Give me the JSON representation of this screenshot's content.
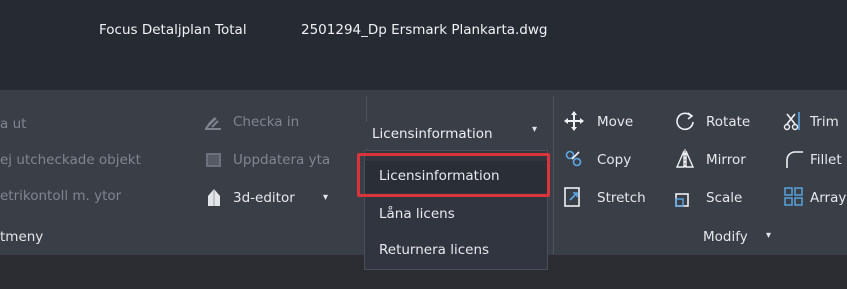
{
  "titlebar": {
    "app_name": "Focus Detaljplan Total",
    "file_name": "2501294_Dp Ersmark Plankarta.dwg"
  },
  "left_panel": {
    "items": [
      "a ut",
      "ej utcheckade objekt",
      "etrikontoll m. ytor"
    ],
    "label": "tmeny"
  },
  "focus_panel": {
    "checka_in": "Checka in",
    "uppdatera_yta": "Uppdatera yta",
    "3d_editor": "3d-editor",
    "3d_editor_caret": "▾"
  },
  "license": {
    "button_label": "Licensinformation",
    "caret": "▾",
    "menu": [
      {
        "label": "Licensinformation",
        "selected": true
      },
      {
        "label": "Låna licens",
        "selected": false
      },
      {
        "label": "Returnera licens",
        "selected": false
      }
    ],
    "highlight_color": "#d9343a"
  },
  "modify_panel": {
    "move": "Move",
    "copy": "Copy",
    "stretch": "Stretch",
    "rotate": "Rotate",
    "mirror": "Mirror",
    "scale": "Scale",
    "trim": "Trim",
    "fillet": "Fillet",
    "array": "Array",
    "label": "Modify",
    "label_caret": "▾"
  }
}
